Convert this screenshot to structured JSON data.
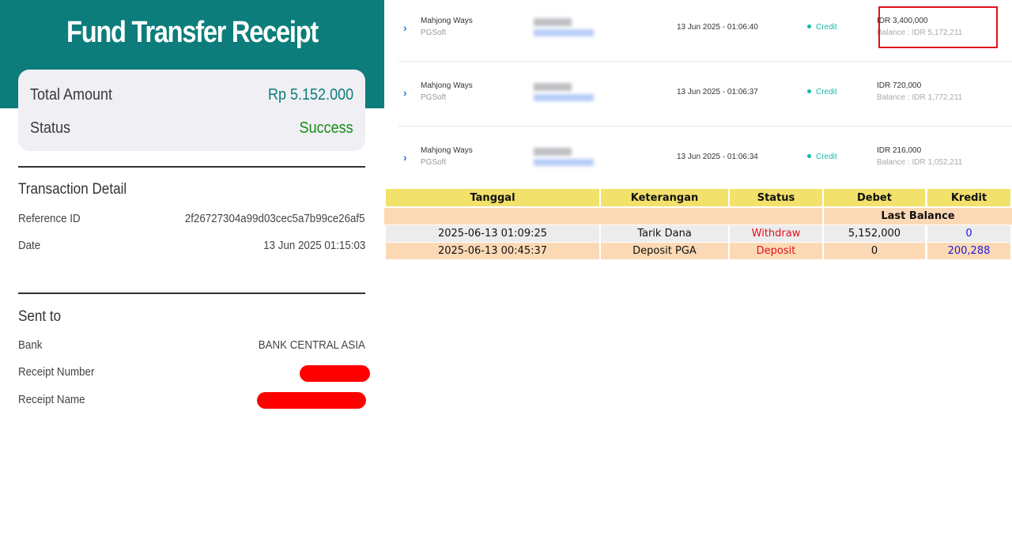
{
  "receipt": {
    "title": "Fund Transfer Receipt",
    "total_amount_label": "Total Amount",
    "total_amount_value": "Rp 5.152.000",
    "status_label": "Status",
    "status_value": "Success",
    "transaction_detail_title": "Transaction Detail",
    "reference_id_label": "Reference ID",
    "reference_id_value": "2f26727304a99d03cec5a7b99ce26af5",
    "date_label": "Date",
    "date_value": "13 Jun 2025 01:15:03",
    "sent_to_title": "Sent to",
    "bank_label": "Bank",
    "bank_value": "BANK CENTRAL ASIA",
    "receipt_number_label": "Receipt Number",
    "receipt_name_label": "Receipt Name",
    "colors": {
      "teal": "#0c7d7b",
      "success": "#178a17",
      "redaction": "#ff0000"
    }
  },
  "history": {
    "rows": [
      {
        "game": "Mahjong Ways",
        "provider": "PGSoft",
        "datetime": "13 Jun 2025 - 01:06:40",
        "type": "Credit",
        "amount": "IDR 3,400,000",
        "balance": "Balance : IDR 5,172,211",
        "highlighted": true
      },
      {
        "game": "Mahjong Ways",
        "provider": "PGSoft",
        "datetime": "13 Jun 2025 - 01:06:37",
        "type": "Credit",
        "amount": "IDR 720,000",
        "balance": "Balance : IDR 1,772,211",
        "highlighted": false
      },
      {
        "game": "Mahjong Ways",
        "provider": "PGSoft",
        "datetime": "13 Jun 2025 - 01:06:34",
        "type": "Credit",
        "amount": "IDR 216,000",
        "balance": "Balance : IDR 1,052,211",
        "highlighted": false
      }
    ],
    "expand_icon": "chevron-right-icon",
    "colors": {
      "credit": "#19b8a5",
      "highlight": "#e0101a"
    }
  },
  "ledger": {
    "headers": [
      "Tanggal",
      "Keterangan",
      "Status",
      "Debet",
      "Kredit"
    ],
    "last_balance_label": "Last Balance",
    "rows": [
      {
        "tanggal": "2025-06-13 01:09:25",
        "keterangan": "Tarik Dana",
        "status": "Withdraw",
        "debet": "5,152,000",
        "kredit": "0"
      },
      {
        "tanggal": "2025-06-13 00:45:37",
        "keterangan": "Deposit PGA",
        "status": "Deposit",
        "debet": "0",
        "kredit": "200,288"
      }
    ],
    "colors": {
      "header": "#f2e16a",
      "peach": "#fcd9b5",
      "grey": "#ececec",
      "status": "#e0101a",
      "kredit": "#1a1adb"
    }
  }
}
